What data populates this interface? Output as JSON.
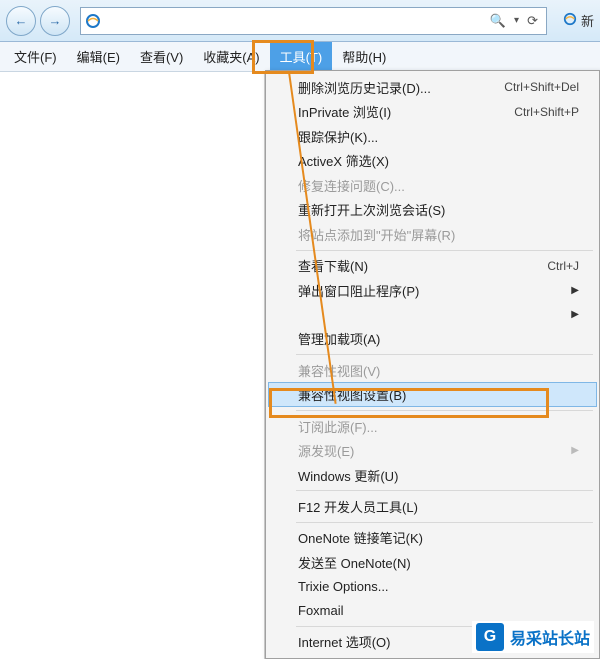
{
  "toolbar": {
    "back": "←",
    "forward": "→",
    "search_icon": "🔍",
    "refresh_icon": "⟳",
    "dropdown_icon": "▾"
  },
  "tab": {
    "label": "新"
  },
  "menubar": {
    "file": "文件(F)",
    "edit": "编辑(E)",
    "view": "查看(V)",
    "favorites": "收藏夹(A)",
    "tools": "工具(T)",
    "help": "帮助(H)"
  },
  "menu": {
    "delete_history": "删除浏览历史记录(D)...",
    "delete_history_sc": "Ctrl+Shift+Del",
    "inprivate": "InPrivate 浏览(I)",
    "inprivate_sc": "Ctrl+Shift+P",
    "tracking": "跟踪保护(K)...",
    "activex": "ActiveX 筛选(X)",
    "fix_conn": "修复连接问题(C)...",
    "reopen": "重新打开上次浏览会话(S)",
    "add_start": "将站点添加到\"开始\"屏幕(R)",
    "downloads": "查看下载(N)",
    "downloads_sc": "Ctrl+J",
    "popup": "弹出窗口阻止程序(P)",
    "smartscreen": "",
    "addons": "管理加载项(A)",
    "compat_view": "兼容性视图(V)",
    "compat_settings": "兼容性视图设置(B)",
    "subscribe": "订阅此源(F)...",
    "feed_discover": "源发现(E)",
    "windows_update": "Windows 更新(U)",
    "f12": "F12 开发人员工具(L)",
    "onenote_link": "OneNote 链接笔记(K)",
    "send_onenote": "发送至 OneNote(N)",
    "trixie": "Trixie Options...",
    "foxmail": "Foxmail",
    "internet_options": "Internet 选项(O)"
  },
  "watermark": {
    "badge": "G",
    "text": "易采站长站"
  }
}
